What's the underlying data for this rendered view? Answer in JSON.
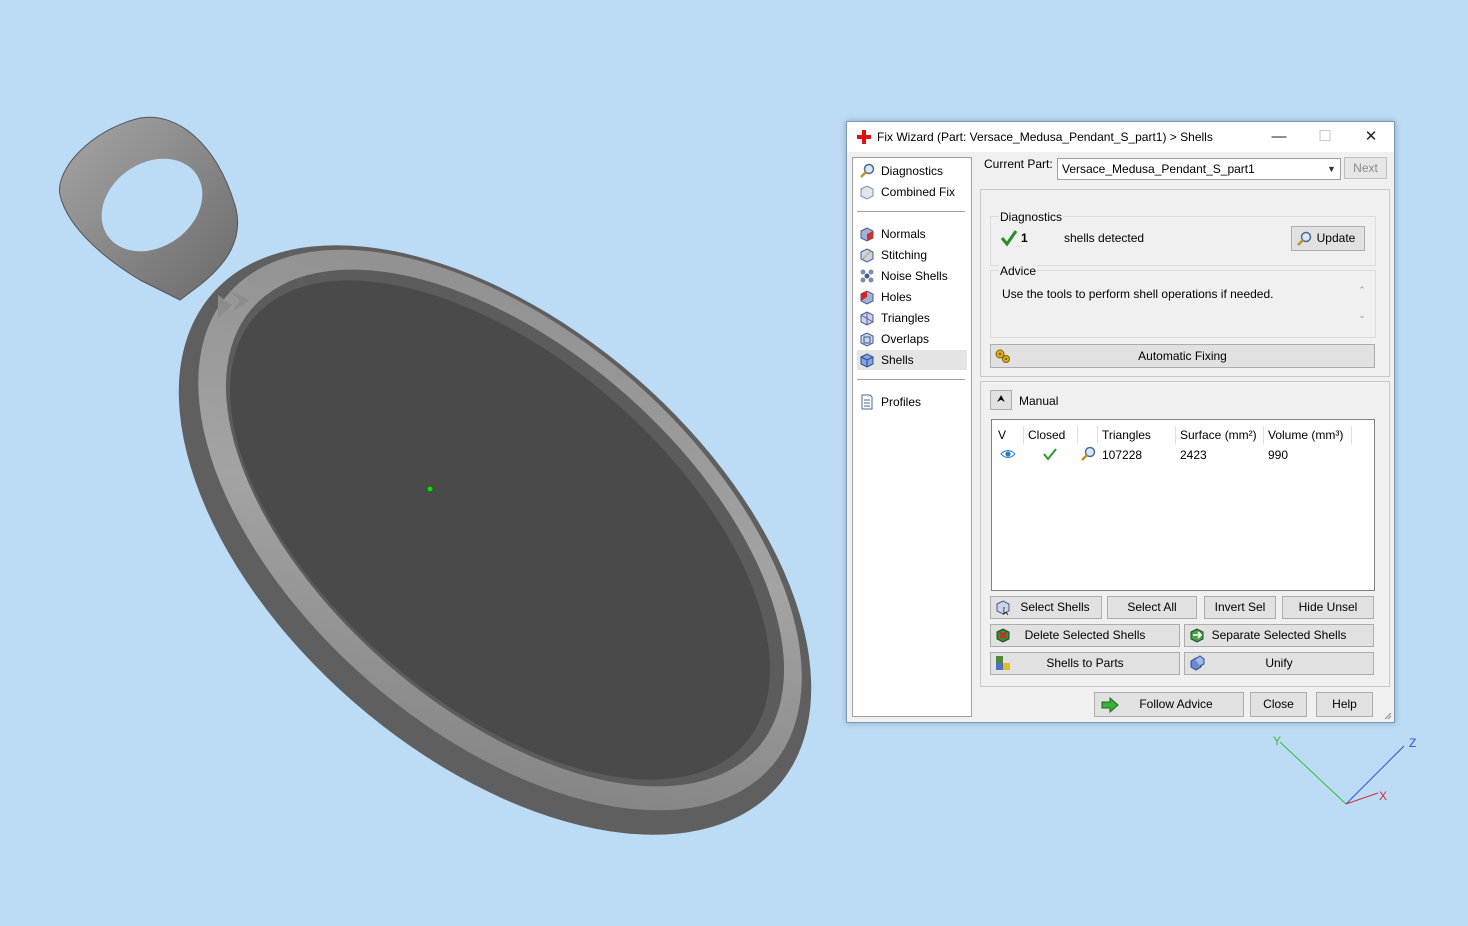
{
  "window": {
    "title": "Fix Wizard (Part: Versace_Medusa_Pendant_S_part1) > Shells",
    "minimize": "—",
    "maximize": "☐",
    "close": "✕"
  },
  "nav": {
    "top": [
      "Diagnostics",
      "Combined Fix"
    ],
    "tools": [
      "Normals",
      "Stitching",
      "Noise Shells",
      "Holes",
      "Triangles",
      "Overlaps",
      "Shells"
    ],
    "bottom": [
      "Profiles"
    ],
    "selected": "Shells"
  },
  "current_part": {
    "label": "Current Part:",
    "value": "Versace_Medusa_Pendant_S_part1",
    "next_label": "Next"
  },
  "diagnostics": {
    "title": "Diagnostics",
    "count": "1",
    "text": "shells detected",
    "update_label": "Update"
  },
  "advice": {
    "title": "Advice",
    "text": "Use the tools to perform shell operations if needed."
  },
  "automatic_fixing_label": "Automatic Fixing",
  "manual": {
    "title": "Manual",
    "columns": [
      "V",
      "Closed",
      "",
      "Triangles",
      "Surface (mm²)",
      "Volume (mm³)"
    ],
    "rows": [
      {
        "triangles": "107228",
        "surface": "2423",
        "volume": "990"
      }
    ]
  },
  "buttons": {
    "select_shells": "Select Shells",
    "select_all": "Select All",
    "invert_sel": "Invert Sel",
    "hide_unsel": "Hide Unsel",
    "delete_selected": "Delete Selected Shells",
    "separate_selected": "Separate Selected Shells",
    "shells_to_parts": "Shells to Parts",
    "unify": "Unify",
    "follow_advice": "Follow Advice",
    "close": "Close",
    "help": "Help"
  },
  "axes": {
    "x": "X",
    "y": "Y",
    "z": "Z"
  },
  "colors": {
    "background": "#bcdcf5",
    "model": "#6f6f6f",
    "model_dark": "#4a4a4a"
  }
}
